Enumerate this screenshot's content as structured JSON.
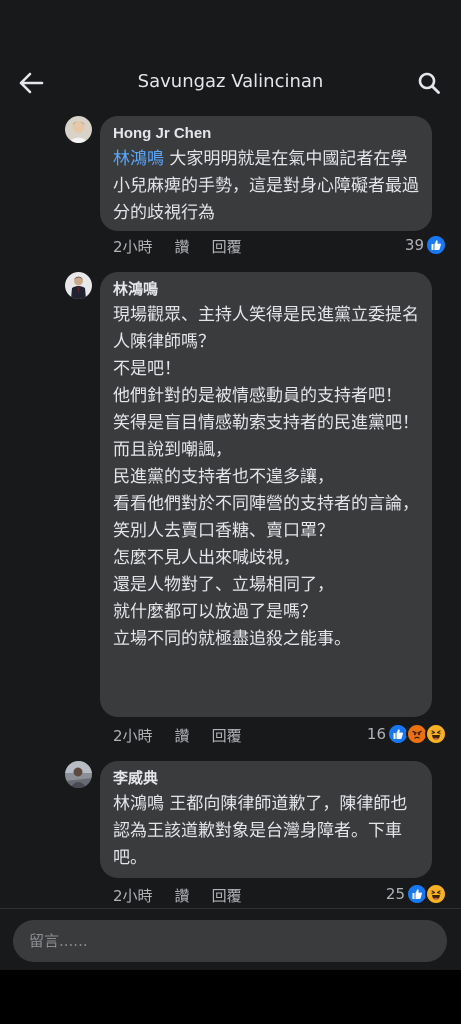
{
  "header": {
    "title": "Savungaz Valincinan",
    "back_icon": "arrow-left-icon",
    "search_icon": "search-icon"
  },
  "colors": {
    "background": "#18191a",
    "bubble": "#3a3b3c",
    "text": "#e4e6eb",
    "secondary_text": "#b0b3b8",
    "mention": "#5aa7ff",
    "like_blue": "#1877f2",
    "angry_orange": "#e9710f",
    "haha_yellow": "#f7b125"
  },
  "comments": [
    {
      "author": "Hong Jr Chen",
      "mention": "林鴻鳴",
      "text": " 大家明明就是在氣中國記者在學小兒麻痺的手勢，這是對身心障礙者最過分的歧視行為",
      "time": "2小時",
      "like_label": "讚",
      "reply_label": "回覆",
      "reaction_count": "39",
      "reactions": [
        "like-icon"
      ]
    },
    {
      "author": "林鴻鳴",
      "mention": "",
      "text": "現場觀眾、主持人笑得是民進黨立委提名人陳律師嗎？\n不是吧！\n他們針對的是被情感動員的支持者吧！\n笑得是盲目情感勒索支持者的民進黨吧！\n而且說到嘲諷，\n民進黨的支持者也不遑多讓，\n看看他們對於不同陣營的支持者的言論，\n笑別人去賣口香糖、賣口罩？\n怎麼不見人出來喊歧視，\n還是人物對了、立場相同了，\n就什麼都可以放過了是嗎？\n立場不同的就極盡追殺之能事。",
      "time": "2小時",
      "like_label": "讚",
      "reply_label": "回覆",
      "reaction_count": "16",
      "reactions": [
        "like-icon",
        "angry-icon",
        "haha-icon"
      ]
    },
    {
      "author": "李威典",
      "mention": "",
      "text": "林鴻鳴 王都向陳律師道歉了，陳律師也認為王該道歉對象是台灣身障者。下車吧。",
      "time": "2小時",
      "like_label": "讚",
      "reply_label": "回覆",
      "reaction_count": "25",
      "reactions": [
        "like-icon",
        "haha-icon"
      ]
    }
  ],
  "input": {
    "placeholder": "留言......"
  }
}
